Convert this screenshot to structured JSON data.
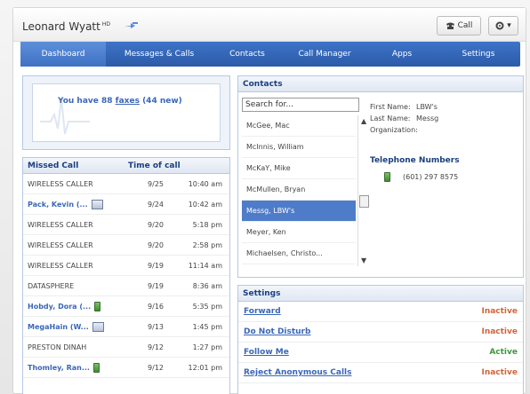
{
  "user": {
    "name": "Leonard Wyatt",
    "sup": "HD"
  },
  "toolbar": {
    "call_label": "Call"
  },
  "nav": [
    "Dashboard",
    "Messages & Calls",
    "Contacts",
    "Call Manager",
    "Apps",
    "Settings"
  ],
  "fax": {
    "prefix": "You have ",
    "count": "88",
    "link": "faxes",
    "suffix": " (44 new)"
  },
  "missed": {
    "col_name": "Missed Call",
    "col_time": "Time of call",
    "rows": [
      {
        "name": "WIRELESS CALLER",
        "date": "9/25",
        "time": "10:40 am"
      },
      {
        "name": "Pack, Kevin (...",
        "date": "9/24",
        "time": "10:42 am"
      },
      {
        "name": "WIRELESS CALLER",
        "date": "9/20",
        "time": "5:18 pm"
      },
      {
        "name": "WIRELESS CALLER",
        "date": "9/20",
        "time": "2:58 pm"
      },
      {
        "name": "WIRELESS CALLER",
        "date": "9/19",
        "time": "11:14 am"
      },
      {
        "name": "DATASPHERE",
        "date": "9/19",
        "time": "8:36 am"
      },
      {
        "name": "Hobdy, Dora (...",
        "date": "9/16",
        "time": "5:35 pm"
      },
      {
        "name": "MegaHain (W...",
        "date": "9/13",
        "time": "1:45 pm"
      },
      {
        "name": "PRESTON DINAH",
        "date": "9/12",
        "time": "1:27 pm"
      },
      {
        "name": "Thomley, Ran...",
        "date": "9/12",
        "time": "12:01 pm"
      }
    ]
  },
  "contacts": {
    "title": "Contacts",
    "search_value": "Search for...",
    "list": [
      "McGee, Mac",
      "McInnis, William",
      "McKaY, Mike",
      "McMullen, Bryan",
      "Messg, LBW's",
      "Meyer, Ken",
      "Michaelsen, Christo..."
    ],
    "detail": {
      "first_label": "First Name:",
      "first": "LBW's",
      "last_label": "Last Name:",
      "last": "Messg",
      "org_label": "Organization:",
      "org": ""
    },
    "tel_head": "Telephone Numbers",
    "tel_number": "(601) 297 8575"
  },
  "settings": {
    "title": "Settings",
    "rows": [
      {
        "label": "Forward",
        "status": "Inactive"
      },
      {
        "label": "Do Not Disturb",
        "status": "Inactive"
      },
      {
        "label": "Follow Me",
        "status": "Active"
      },
      {
        "label": "Reject Anonymous Calls",
        "status": "Inactive"
      }
    ]
  },
  "colors": {
    "nav": "#2c5ba8",
    "active_status": "#3c9a3c",
    "inactive_status": "#d2643a",
    "link": "#3a67b8"
  }
}
